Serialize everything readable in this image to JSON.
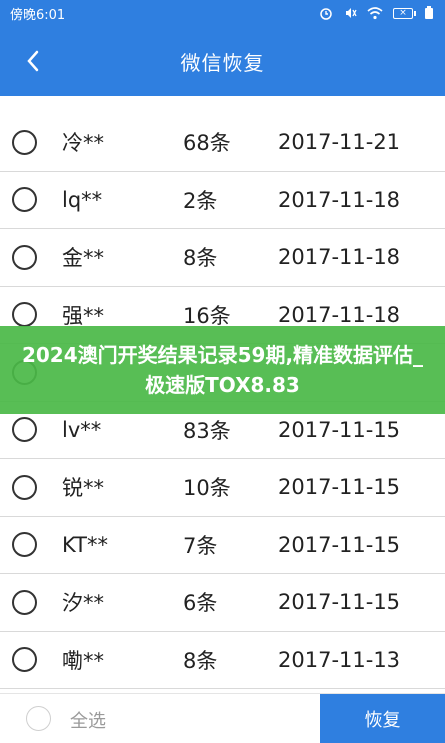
{
  "status_bar": {
    "time": "傍晚6:01",
    "icons": [
      "alarm-icon",
      "mute-icon",
      "wifi-icon",
      "battery-icon"
    ]
  },
  "header": {
    "title": "微信恢复",
    "back_icon": "chevron-left-icon"
  },
  "rows": [
    {
      "name": "冷**",
      "count": "68条",
      "date": "2017-11-21"
    },
    {
      "name": "lq**",
      "count": "2条",
      "date": "2017-11-18"
    },
    {
      "name": "金**",
      "count": "8条",
      "date": "2017-11-18"
    },
    {
      "name": "强**",
      "count": "16条",
      "date": "2017-11-18"
    },
    {
      "name": "",
      "count": "",
      "date": ""
    },
    {
      "name": "lv**",
      "count": "83条",
      "date": "2017-11-15"
    },
    {
      "name": "锐**",
      "count": "10条",
      "date": "2017-11-15"
    },
    {
      "name": "KT**",
      "count": "7条",
      "date": "2017-11-15"
    },
    {
      "name": "汐**",
      "count": "6条",
      "date": "2017-11-15"
    },
    {
      "name": "嘞**",
      "count": "8条",
      "date": "2017-11-13"
    }
  ],
  "overlay": {
    "text": "2024澳门开奖结果记录59期,精准数据评估_极速版TOX8.83"
  },
  "bottom": {
    "select_all": "全选",
    "recover": "恢复"
  },
  "colors": {
    "primary": "#2f7fe0",
    "overlay": "#4ab846"
  }
}
